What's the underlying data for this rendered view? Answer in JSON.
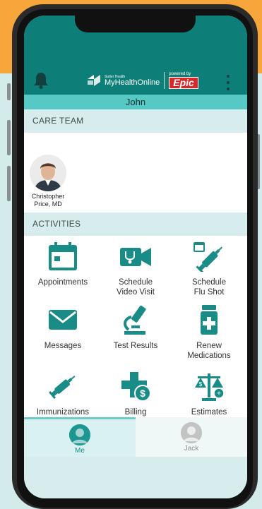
{
  "app": {
    "brand_small": "Sutter Health",
    "brand_name": "MyHealthOnline",
    "powered_by": "powered by",
    "epic_label": "Epic",
    "patient_name": "John"
  },
  "care_team": {
    "header": "CARE TEAM",
    "members": [
      {
        "name_line1": "Christopher",
        "name_line2": "Price, MD"
      }
    ]
  },
  "activities": {
    "header": "ACTIVITIES",
    "items": [
      {
        "label1": "Appointments",
        "label2": "",
        "icon": "calendar-icon"
      },
      {
        "label1": "Schedule",
        "label2": "Video Visit",
        "icon": "video-stethoscope-icon"
      },
      {
        "label1": "Schedule",
        "label2": "Flu Shot",
        "icon": "syringe-calendar-icon"
      },
      {
        "label1": "Messages",
        "label2": "",
        "icon": "envelope-icon"
      },
      {
        "label1": "Test Results",
        "label2": "",
        "icon": "microscope-icon"
      },
      {
        "label1": "Renew",
        "label2": "Medications",
        "icon": "pill-bottle-icon"
      },
      {
        "label1": "Immunizations",
        "label2": "",
        "icon": "syringe-icon"
      },
      {
        "label1": "Billing",
        "label2": "",
        "icon": "billing-cross-icon"
      },
      {
        "label1": "Estimates",
        "label2": "",
        "icon": "scale-icon"
      }
    ]
  },
  "tabs": [
    {
      "label": "Me",
      "active": true
    },
    {
      "label": "Jack",
      "active": false
    }
  ],
  "colors": {
    "appbar": "#0e7e79",
    "accent": "#1a8c88",
    "namebar": "#56c9c5"
  }
}
